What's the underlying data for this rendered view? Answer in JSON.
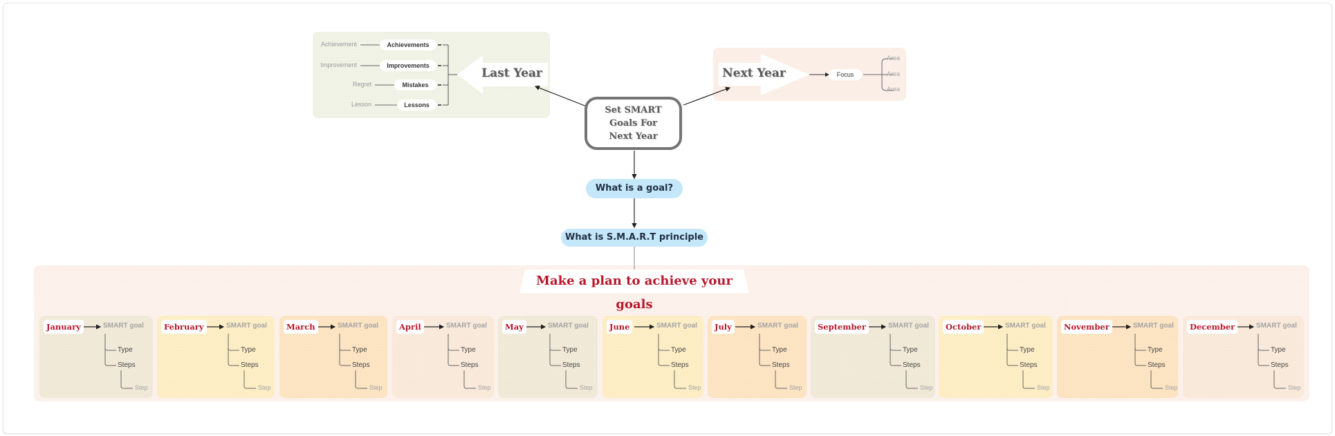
{
  "central_node": {
    "label_lines": [
      "Set SMART",
      "Goals For",
      "Next Year"
    ]
  },
  "last_year": {
    "label": "Last Year",
    "branches": [
      {
        "label": "Achievements",
        "sub": "Achievement"
      },
      {
        "label": "Improvements",
        "sub": "Improvement"
      },
      {
        "label": "Mistakes",
        "sub": "Regret"
      },
      {
        "label": "Lessons",
        "sub": "Lesson"
      }
    ],
    "color": "#f1f3e6"
  },
  "next_year": {
    "label": "Next Year",
    "focus": "Focus",
    "areas": [
      "Area",
      "Area",
      "Area"
    ],
    "color": "#fcefe8"
  },
  "questions": {
    "goal": "What is a goal?",
    "smart": "What is S.M.A.R.T principle",
    "color": "#c5e7fa"
  },
  "plan": {
    "title": "Make a plan to achieve your goals",
    "title_color": "#b8172a",
    "months": [
      {
        "name": "January",
        "goal": "SMART goal",
        "type": "Type",
        "steps": "Steps",
        "step": "Step",
        "color": "#f1ead9"
      },
      {
        "name": "February",
        "goal": "SMART goal",
        "type": "Type",
        "steps": "Steps",
        "step": "Step",
        "color": "#fdeec6"
      },
      {
        "name": "March",
        "goal": "SMART goal",
        "type": "Type",
        "steps": "Steps",
        "step": "Step",
        "color": "#fde4c3"
      },
      {
        "name": "April",
        "goal": "SMART goal",
        "type": "Type",
        "steps": "Steps",
        "step": "Step",
        "color": "#faeadc"
      },
      {
        "name": "May",
        "goal": "SMART goal",
        "type": "Type",
        "steps": "Steps",
        "step": "Step",
        "color": "#f1ead9"
      },
      {
        "name": "June",
        "goal": "SMART goal",
        "type": "Type",
        "steps": "Steps",
        "step": "Step",
        "color": "#fdeec6"
      },
      {
        "name": "July",
        "goal": "SMART goal",
        "type": "Type",
        "steps": "Steps",
        "step": "Step",
        "color": "#fde4c3"
      },
      {
        "name": "September",
        "goal": "SMART goal",
        "type": "Type",
        "steps": "Steps",
        "step": "Step",
        "color": "#f1ead9"
      },
      {
        "name": "October",
        "goal": "SMART goal",
        "type": "Type",
        "steps": "Steps",
        "step": "Step",
        "color": "#fdeec6"
      },
      {
        "name": "November",
        "goal": "SMART goal",
        "type": "Type",
        "steps": "Steps",
        "step": "Step",
        "color": "#fde4c3"
      },
      {
        "name": "December",
        "goal": "SMART goal",
        "type": "Type",
        "steps": "Steps",
        "step": "Step",
        "color": "#faeadc"
      }
    ]
  }
}
